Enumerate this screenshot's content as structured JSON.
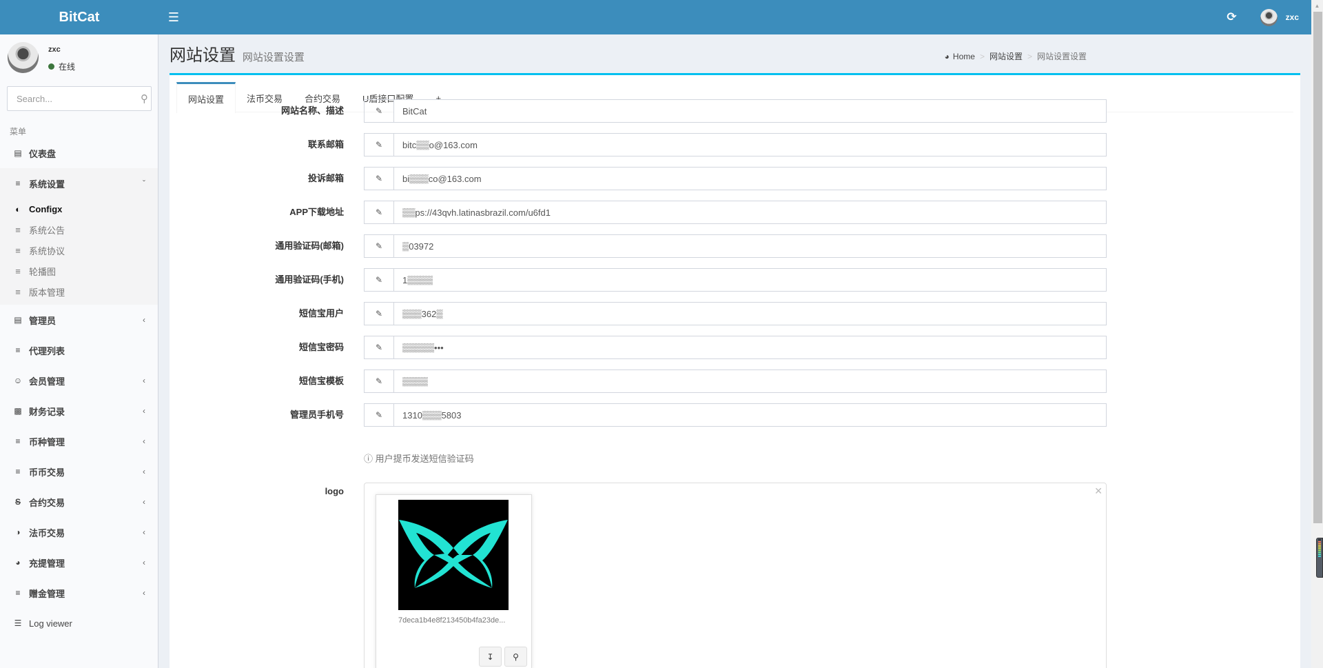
{
  "header": {
    "brand": "BitCat",
    "menu_toggle_icon": "hamburger-icon",
    "refresh_icon": "refresh-icon",
    "user_name": "zxc"
  },
  "sidebar": {
    "user": {
      "name": "zxc",
      "status": "在线",
      "status_color": "#3c763d"
    },
    "search_placeholder": "Search...",
    "menu_header": "菜单",
    "items": [
      {
        "label": "仪表盘",
        "icon": "bar-chart-icon",
        "has_arrow": false
      },
      {
        "label": "系统设置",
        "icon": "sliders-icon",
        "has_arrow": true,
        "expanded": true,
        "children": [
          {
            "label": "Configx",
            "icon": "toggle-on-icon",
            "active": true
          },
          {
            "label": "系统公告",
            "icon": "bars-icon",
            "active": false
          },
          {
            "label": "系统协议",
            "icon": "bars-icon",
            "active": false
          },
          {
            "label": "轮播图",
            "icon": "bars-icon",
            "active": false
          },
          {
            "label": "版本管理",
            "icon": "bars-icon",
            "active": false
          }
        ]
      },
      {
        "label": "管理员",
        "icon": "tasks-icon",
        "has_arrow": true
      },
      {
        "label": "代理列表",
        "icon": "bars-icon",
        "has_arrow": false
      },
      {
        "label": "会员管理",
        "icon": "users-icon",
        "has_arrow": true
      },
      {
        "label": "财务记录",
        "icon": "money-icon",
        "has_arrow": true
      },
      {
        "label": "币种管理",
        "icon": "bars-icon",
        "has_arrow": true
      },
      {
        "label": "币币交易",
        "icon": "bars-icon",
        "has_arrow": true
      },
      {
        "label": "合约交易",
        "icon": "strikethrough-icon",
        "has_arrow": true
      },
      {
        "label": "法币交易",
        "icon": "adjust-icon",
        "has_arrow": true
      },
      {
        "label": "充提管理",
        "icon": "dashboard-icon",
        "has_arrow": true
      },
      {
        "label": "赠金管理",
        "icon": "bars-icon",
        "has_arrow": true
      },
      {
        "label": "Log viewer",
        "icon": "database-icon",
        "has_arrow": false
      }
    ]
  },
  "page": {
    "title": "网站设置",
    "subtitle": "网站设置设置",
    "breadcrumb": [
      {
        "label": "Home",
        "icon": "dashboard-icon"
      },
      {
        "label": "网站设置"
      },
      {
        "label": "网站设置设置"
      }
    ]
  },
  "tabs": [
    {
      "label": "网站设置",
      "active": true
    },
    {
      "label": "法币交易",
      "active": false
    },
    {
      "label": "合约交易",
      "active": false
    },
    {
      "label": "U盾接口配置",
      "active": false
    },
    {
      "label": "+",
      "active": false
    }
  ],
  "form": {
    "fields": [
      {
        "label": "网站名称、描述",
        "value": "BitCat"
      },
      {
        "label": "联系邮箱",
        "value": "bitc▒▒o@163.com"
      },
      {
        "label": "投诉邮箱",
        "value": "bi▒▒▒co@163.com"
      },
      {
        "label": "APP下载地址",
        "value": "▒▒ps://43qvh.latinasbrazil.com/u6fd1"
      },
      {
        "label": "通用验证码(邮箱)",
        "value": "▒03972"
      },
      {
        "label": "通用验证码(手机)",
        "value": "1▒▒▒▒"
      },
      {
        "label": "短信宝用户",
        "value": "▒▒▒362▒"
      },
      {
        "label": "短信宝密码",
        "value": "▒▒▒▒▒•••"
      },
      {
        "label": "短信宝模板",
        "value": "▒▒▒▒"
      },
      {
        "label": "管理员手机号",
        "value": "1310▒▒▒5803"
      }
    ],
    "edit_icon": "pencil-icon",
    "help_text": "用户提币发送短信验证码",
    "help_icon": "info-circle-icon",
    "logo": {
      "label": "logo",
      "filename": "7deca1b4e8f213450b4fa23de...",
      "logo_color": "#22e3d3",
      "download_icon": "download-icon",
      "zoom_icon": "zoom-in-icon",
      "close_icon": "close-icon"
    }
  }
}
